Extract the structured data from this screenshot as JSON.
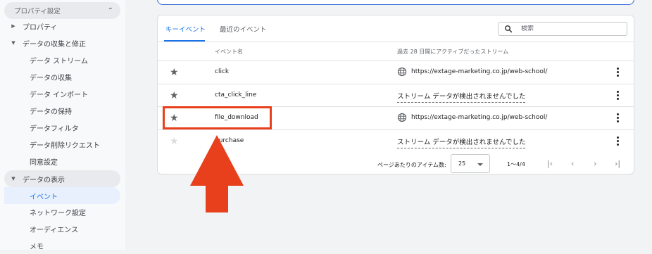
{
  "sidebar": {
    "settings_header": "プロパティ設定",
    "items": [
      {
        "label": "プロパティ"
      },
      {
        "label": "データの収集と修正"
      },
      {
        "label": "データ ストリーム"
      },
      {
        "label": "データの収集"
      },
      {
        "label": "データ インポート"
      },
      {
        "label": "データの保持"
      },
      {
        "label": "データフィルタ"
      },
      {
        "label": "データ削除リクエスト"
      },
      {
        "label": "同意設定"
      },
      {
        "label": "データの表示"
      },
      {
        "label": "イベント"
      },
      {
        "label": "ネットワーク設定"
      },
      {
        "label": "オーディエンス"
      },
      {
        "label": "メモ"
      }
    ]
  },
  "tabs": {
    "key_events": "キーイベント",
    "recent_events": "最近のイベント"
  },
  "search": {
    "placeholder": "検索"
  },
  "table": {
    "col_event_name": "イベント名",
    "col_streams": "過去 28 日間にアクティブだったストリーム",
    "rows": [
      {
        "name": "click",
        "stream": "https://extage-marketing.co.jp/web-school/"
      },
      {
        "name": "cta_click_line",
        "stream": "ストリーム データが検出されませんでした"
      },
      {
        "name": "file_download",
        "stream": "https://extage-marketing.co.jp/web-school/"
      },
      {
        "name": "purchase",
        "stream": "ストリーム データが検出されませんでした"
      }
    ]
  },
  "pagination": {
    "items_per_page_label": "ページあたりのアイテム数:",
    "items_per_page": "25",
    "range": "1〜4/4"
  },
  "colors": {
    "accent": "#1a73e8",
    "annotation": "#e8401c"
  }
}
